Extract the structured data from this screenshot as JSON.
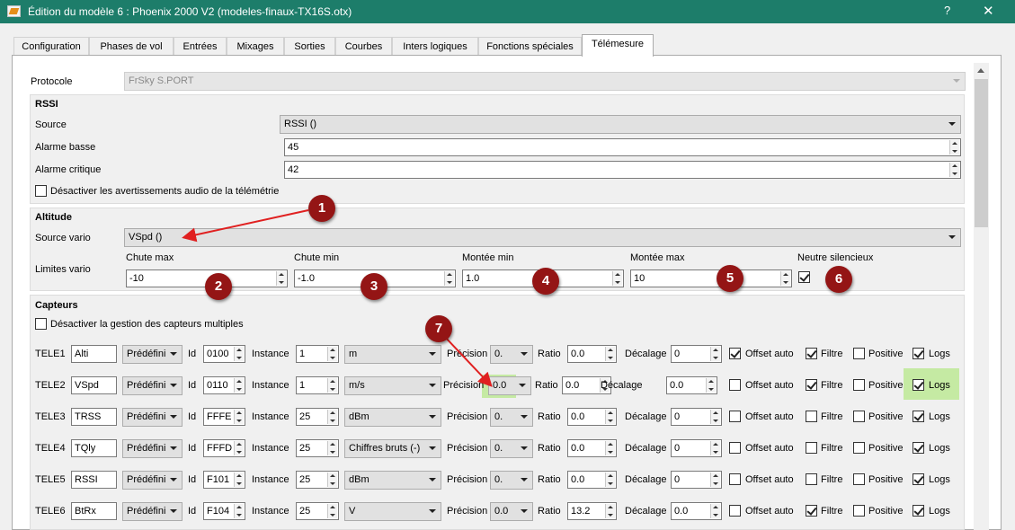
{
  "window": {
    "title": "Édition du modèle 6 : Phoenix 2000 V2   (modeles-finaux-TX16S.otx)",
    "help": "?",
    "close": "✕"
  },
  "tabs": [
    "Configuration",
    "Phases de vol",
    "Entrées",
    "Mixages",
    "Sorties",
    "Courbes",
    "Inters logiques",
    "Fonctions spéciales",
    "Télémesure"
  ],
  "protocol": {
    "label": "Protocole",
    "value": "FrSky S.PORT"
  },
  "rssi": {
    "title": "RSSI",
    "source_label": "Source",
    "source_value": "RSSI ()",
    "low_label": "Alarme basse",
    "low_value": "45",
    "crit_label": "Alarme critique",
    "crit_value": "42",
    "disable_label": "Désactiver les avertissements audio de la télémétrie"
  },
  "altitude": {
    "title": "Altitude",
    "vario_label": "Source vario",
    "vario_value": "VSpd ()",
    "limits_label": "Limites vario",
    "drop_max_label": "Chute max",
    "drop_max_value": "-10",
    "drop_min_label": "Chute min",
    "drop_min_value": "-1.0",
    "climb_min_label": "Montée min",
    "climb_min_value": "1.0",
    "climb_max_label": "Montée max",
    "climb_max_value": "10",
    "neutral_label": "Neutre silencieux"
  },
  "sensors": {
    "title": "Capteurs",
    "disable_label": "Désactiver la gestion des capteurs multiples",
    "labels": {
      "id": "Id",
      "instance": "Instance",
      "precision": "Précision",
      "ratio": "Ratio",
      "offset": "Décalage",
      "auto_offset": "Offset auto",
      "filter": "Filtre",
      "positive": "Positive",
      "logs": "Logs"
    },
    "rows": [
      {
        "name": "TELE1",
        "label": "Alti",
        "type": "Prédéfini",
        "id": "0100",
        "instance": "1",
        "unit": "m",
        "precision": "0.",
        "ratio": "0.0",
        "offset": "0",
        "auto_offset": true,
        "filter": true,
        "positive": false,
        "logs": true
      },
      {
        "name": "TELE2",
        "label": "VSpd",
        "type": "Prédéfini",
        "id": "0110",
        "instance": "1",
        "unit": "m/s",
        "precision": "0.0",
        "ratio": "0.0",
        "offset": "0.0",
        "auto_offset": false,
        "filter": true,
        "positive": false,
        "logs": true
      },
      {
        "name": "TELE3",
        "label": "TRSS",
        "type": "Prédéfini",
        "id": "FFFE",
        "instance": "25",
        "unit": "dBm",
        "precision": "0.",
        "ratio": "0.0",
        "offset": "0",
        "auto_offset": false,
        "filter": false,
        "positive": false,
        "logs": true
      },
      {
        "name": "TELE4",
        "label": "TQly",
        "type": "Prédéfini",
        "id": "FFFD",
        "instance": "25",
        "unit": "Chiffres bruts (-)",
        "precision": "0.",
        "ratio": "0.0",
        "offset": "0",
        "auto_offset": false,
        "filter": false,
        "positive": false,
        "logs": true
      },
      {
        "name": "TELE5",
        "label": "RSSI",
        "type": "Prédéfini",
        "id": "F101",
        "instance": "25",
        "unit": "dBm",
        "precision": "0.",
        "ratio": "0.0",
        "offset": "0",
        "auto_offset": false,
        "filter": false,
        "positive": false,
        "logs": true
      },
      {
        "name": "TELE6",
        "label": "BtRx",
        "type": "Prédéfini",
        "id": "F104",
        "instance": "25",
        "unit": "V",
        "precision": "0.0",
        "ratio": "13.2",
        "offset": "0.0",
        "auto_offset": false,
        "filter": true,
        "positive": false,
        "logs": true
      }
    ]
  },
  "annotations": [
    "1",
    "2",
    "3",
    "4",
    "5",
    "6",
    "7"
  ],
  "colors": {
    "titlebar": "#1d7d6a",
    "badge": "#941515",
    "arrow": "#e02020",
    "highlight": "#c5eaa3"
  }
}
